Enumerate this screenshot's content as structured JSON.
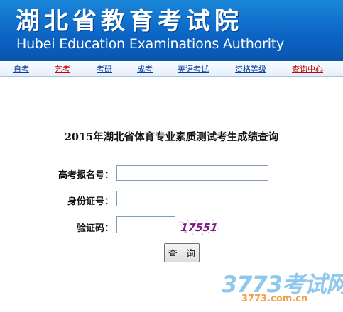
{
  "header": {
    "title": "湖北省教育考试院",
    "subtitle": "Hubei Education Examinations Authority"
  },
  "nav": {
    "items": [
      {
        "label": "自考"
      },
      {
        "label": "艺考",
        "color": "#c40000"
      },
      {
        "label": "考研"
      },
      {
        "label": "成考"
      },
      {
        "label": "英语考试"
      },
      {
        "label": "资格等级"
      },
      {
        "label": "查询中心",
        "color": "#c40000"
      }
    ]
  },
  "form": {
    "title": "2015年湖北省体育专业素质测试考生成绩查询",
    "fields": {
      "exam_number": {
        "label": "高考报名号：",
        "value": ""
      },
      "id_number": {
        "label": "身份证号：",
        "value": ""
      },
      "captcha": {
        "label": "验证码：",
        "value": "",
        "image_text": "17551"
      }
    },
    "submit_label": "查 询"
  },
  "watermark": {
    "main": "3773考试网",
    "sub": "3773.com.cn"
  },
  "colors": {
    "header_blue": "#0b63c4",
    "nav_link": "#0a3d9c",
    "nav_highlight": "#c40000",
    "captcha_text": "#7a1a7a"
  }
}
